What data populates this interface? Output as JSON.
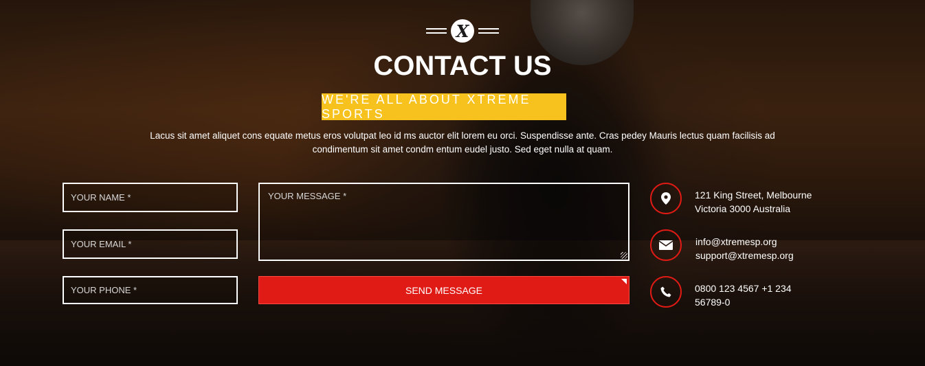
{
  "header": {
    "logo_letter": "X",
    "title": "CONTACT US",
    "tagline": "WE'RE ALL ABOUT XTREME SPORTS",
    "tagline_color": "#f7c21d",
    "description_line1": "Lacus sit amet aliquet cons equate metus eros volutpat leo id ms auctor elit lorem eu orci. Suspendisse ante. Cras pedey Mauris lectus quam facilisis ad",
    "description_line2": "condimentum sit amet condm entum eudel justo. Sed eget nulla at quam."
  },
  "form": {
    "name_placeholder": "YOUR NAME *",
    "email_placeholder": "YOUR EMAIL *",
    "phone_placeholder": "YOUR PHONE *",
    "message_placeholder": "YOUR MESSAGE *",
    "send_label": "SEND MESSAGE",
    "send_color": "#e01a14"
  },
  "contact": {
    "address_icon": "map-pin-icon",
    "address_line1": "121 King Street, Melbourne",
    "address_line2": "Victoria 3000 Australia",
    "email_icon": "envelope-icon",
    "email_line1": "info@xtremesp.org",
    "email_line2": "support@xtremesp.org",
    "phone_icon": "phone-icon",
    "phone_line1": "0800 123 4567 +1 234",
    "phone_line2": "56789-0",
    "accent_color": "#e01a14"
  }
}
